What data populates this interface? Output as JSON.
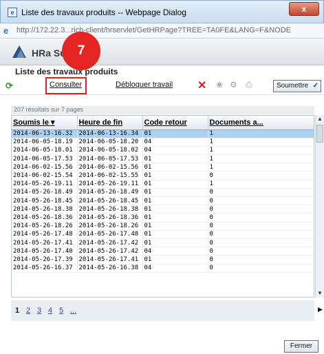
{
  "window": {
    "title": "Liste des travaux produits -- Webpage Dialog",
    "close_label": "x",
    "url": "http://172.22.3...rich-client/hrservlet/GetHRPage?TREE=TA0FE&LANG=F&NODE"
  },
  "app": {
    "brand": "HRa Suit"
  },
  "step_badge": "7",
  "page": {
    "title": "Liste des travaux produits"
  },
  "toolbar": {
    "consulter": "Consulter",
    "debloquer": "Débloquer travail",
    "submit_select": "Soumettre"
  },
  "results": {
    "count_text": "207 résultats sur 7 pages"
  },
  "table": {
    "columns": [
      "Soumis le ▾",
      "Heure de fin",
      "Code retour",
      "Documents a..."
    ],
    "rows": [
      [
        "2014-06-13-16.32",
        "2014-06-13-16.34",
        "01",
        "1"
      ],
      [
        "2014-06-05-18.19",
        "2014-06-05-18.20",
        "04",
        "1"
      ],
      [
        "2014-06-05-18.01",
        "2014-06-05-18.02",
        "04",
        "1"
      ],
      [
        "2014-06-05-17.53",
        "2014-06-05-17.53",
        "01",
        "1"
      ],
      [
        "2014-06-02-15.56",
        "2014-06-02-15.56",
        "01",
        "1"
      ],
      [
        "2014-06-02-15.54",
        "2014-06-02-15.55",
        "01",
        "0"
      ],
      [
        "2014-05-26-19.11",
        "2014-05-26-19.11",
        "01",
        "1"
      ],
      [
        "2014-05-26-18.49",
        "2014-05-26-18.49",
        "01",
        "0"
      ],
      [
        "2014-05-26-18.45",
        "2014-05-26-18.45",
        "01",
        "0"
      ],
      [
        "2014-05-26-18.38",
        "2014-05-26-18.38",
        "01",
        "0"
      ],
      [
        "2014-05-26-18.36",
        "2014-05-26-18.36",
        "01",
        "0"
      ],
      [
        "2014-05-26-18.26",
        "2014-05-26-18.26",
        "01",
        "0"
      ],
      [
        "2014-05-26-17.48",
        "2014-05-26-17.48",
        "01",
        "0"
      ],
      [
        "2014-05-26-17.41",
        "2014-05-26-17.42",
        "01",
        "0"
      ],
      [
        "2014-05-26-17.40",
        "2014-05-26-17.42",
        "04",
        "0"
      ],
      [
        "2014-05-26-17.39",
        "2014-05-26-17.41",
        "01",
        "0"
      ],
      [
        "2014-05-26-16.37",
        "2014-05-26-16.38",
        "04",
        "0"
      ]
    ]
  },
  "pagination": {
    "pages": [
      "1",
      "2",
      "3",
      "4",
      "5",
      "..."
    ]
  },
  "footer": {
    "close_button": "Fermer"
  },
  "icons": [
    "app-icon",
    "ie-icon",
    "logo-icon",
    "refresh-icon",
    "delete-icon",
    "bulb-icon",
    "tools-icon",
    "print-icon",
    "chevron-down-icon",
    "scroll-up-icon",
    "scroll-down-icon",
    "pager-next-icon"
  ],
  "colors": {
    "selected_row": "#a9d2f4",
    "badge": "#e52424",
    "highlight": "#d91f1f",
    "delete": "#d71f1f",
    "refresh": "#2e9a2e"
  }
}
